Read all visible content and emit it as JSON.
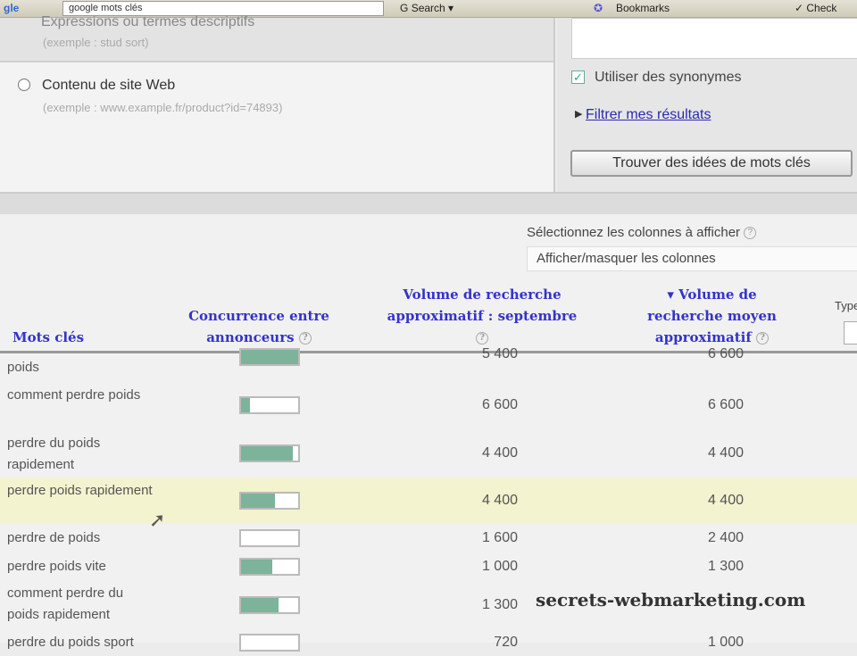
{
  "browser": {
    "search_value": "google mots clés",
    "search_label": "Search",
    "bookmarks_label": "Bookmarks",
    "check_label": "Check"
  },
  "form": {
    "option1": {
      "label": "Expressions ou termes descriptifs",
      "example": "(exemple : stud sort)"
    },
    "option2": {
      "label": "Contenu de site Web",
      "example": "(exemple : www.example.fr/product?id=74893)"
    },
    "synonyms_label": "Utiliser des synonymes",
    "synonyms_checked": true,
    "filter_link": "Filtrer mes résultats",
    "find_button": "Trouver des idées de mots clés"
  },
  "columns": {
    "label": "Sélectionnez les colonnes à afficher",
    "select_value": "Afficher/masquer les colonnes",
    "help": "?"
  },
  "table": {
    "headers": {
      "keyword": "Mots clés",
      "competition": "Concurrence entre annonceurs",
      "volume_month": "Volume de recherche approximatif : septembre",
      "volume_avg": "▾ Volume de recherche moyen approximatif",
      "type": "Type"
    },
    "rows": [
      {
        "keyword": "poids",
        "competition": 1.0,
        "volume_month": "5 400",
        "volume_avg": "6 600"
      },
      {
        "keyword": "comment perdre poids",
        "competition": 0.15,
        "volume_month": "6 600",
        "volume_avg": "6 600"
      },
      {
        "keyword": "perdre du poids rapidement",
        "competition": 0.9,
        "volume_month": "4 400",
        "volume_avg": "4 400"
      },
      {
        "keyword": "perdre poids rapidement",
        "competition": 0.6,
        "volume_month": "4 400",
        "volume_avg": "4 400"
      },
      {
        "keyword": "perdre de poids",
        "competition": 0.0,
        "volume_month": "1 600",
        "volume_avg": "2 400"
      },
      {
        "keyword": "perdre poids vite",
        "competition": 0.55,
        "volume_month": "1 000",
        "volume_avg": "1 300"
      },
      {
        "keyword": "comment perdre du poids rapidement",
        "competition": 0.65,
        "volume_month": "1 300",
        "volume_avg": ""
      },
      {
        "keyword": "perdre du poids sport",
        "competition": 0.0,
        "volume_month": "720",
        "volume_avg": "1 000"
      }
    ]
  },
  "watermark": "secrets-webmarketing.com",
  "colors": {
    "link": "#3333cc",
    "bar": "#7db39a",
    "highlight": "#f3f3cf"
  }
}
